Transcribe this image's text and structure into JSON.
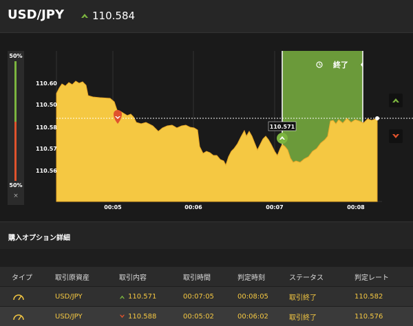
{
  "header": {
    "pair": "USD/JPY",
    "price": "110.584",
    "direction_icon": "up-arrow-icon",
    "up_color": "#7cb53f"
  },
  "gauge": {
    "top_label": "50%",
    "bottom_label": "50%",
    "close": "×",
    "up_color": "#7cb53f",
    "down_color": "#e0532d"
  },
  "chart": {
    "end_label": "終了",
    "marker_label": "110.571",
    "colors": {
      "area": "#f5c842",
      "area_edge": "#e8a82a",
      "zone": "#6b9a3a",
      "up": "#7cb53f",
      "down": "#e0532d"
    },
    "chart_data": {
      "type": "area",
      "y_tick_labels": [
        "110.60",
        "110.50",
        "110.58",
        "110.57",
        "110.56"
      ],
      "x_tick_labels": [
        "00:05",
        "00:06",
        "00:07",
        "00:08"
      ],
      "current_price": 110.584,
      "entry_up": {
        "time": "00:07:05",
        "price": 110.571
      },
      "entry_down": {
        "time": "00:05:02",
        "price": 110.588
      },
      "expiry_zone": [
        "00:07:05",
        "00:08:05"
      ]
    }
  },
  "section": {
    "title": "購入オプション詳細"
  },
  "table": {
    "headers": [
      "タイプ",
      "取引原資産",
      "取引内容",
      "取引時間",
      "判定時刻",
      "ステータス",
      "判定レート"
    ],
    "rows": [
      {
        "type_icon": "gauge-icon",
        "asset": "USD/JPY",
        "direction": "up",
        "direction_icon": "up-arrow-icon",
        "rate": "110.571",
        "time": "00:07:05",
        "judge_time": "00:08:05",
        "status": "取引終了",
        "judge_rate": "110.582"
      },
      {
        "type_icon": "gauge-icon",
        "asset": "USD/JPY",
        "direction": "down",
        "direction_icon": "down-arrow-icon",
        "rate": "110.588",
        "time": "00:05:02",
        "judge_time": "00:06:02",
        "status": "取引終了",
        "judge_rate": "110.576"
      }
    ]
  }
}
